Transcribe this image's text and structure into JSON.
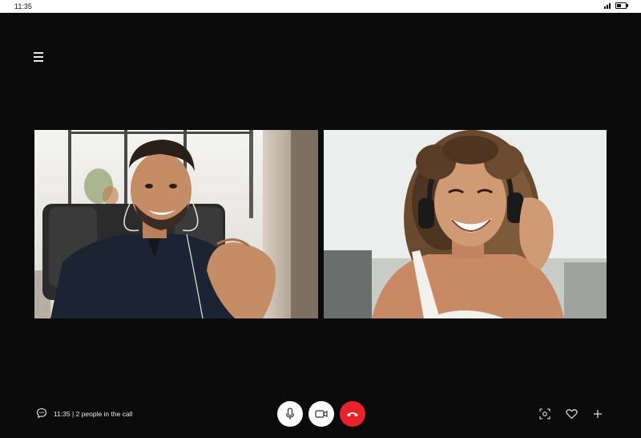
{
  "status_bar": {
    "time": "11:35"
  },
  "call": {
    "info_text": "11:35 | 2 people in the call",
    "participants": [
      {
        "tile": "participant-1",
        "description": "man in dark shirt"
      },
      {
        "tile": "participant-2",
        "description": "woman with headphones"
      }
    ]
  },
  "controls": {
    "mic": "microphone-icon",
    "video": "video-camera-icon",
    "end": "phone-hangup-icon"
  },
  "actions": {
    "screenshot": "screenshot-icon",
    "like": "heart-icon",
    "add": "plus-icon"
  },
  "colors": {
    "background": "#0b0b0b",
    "end_call": "#e8212b",
    "control_bg": "#ffffff"
  }
}
